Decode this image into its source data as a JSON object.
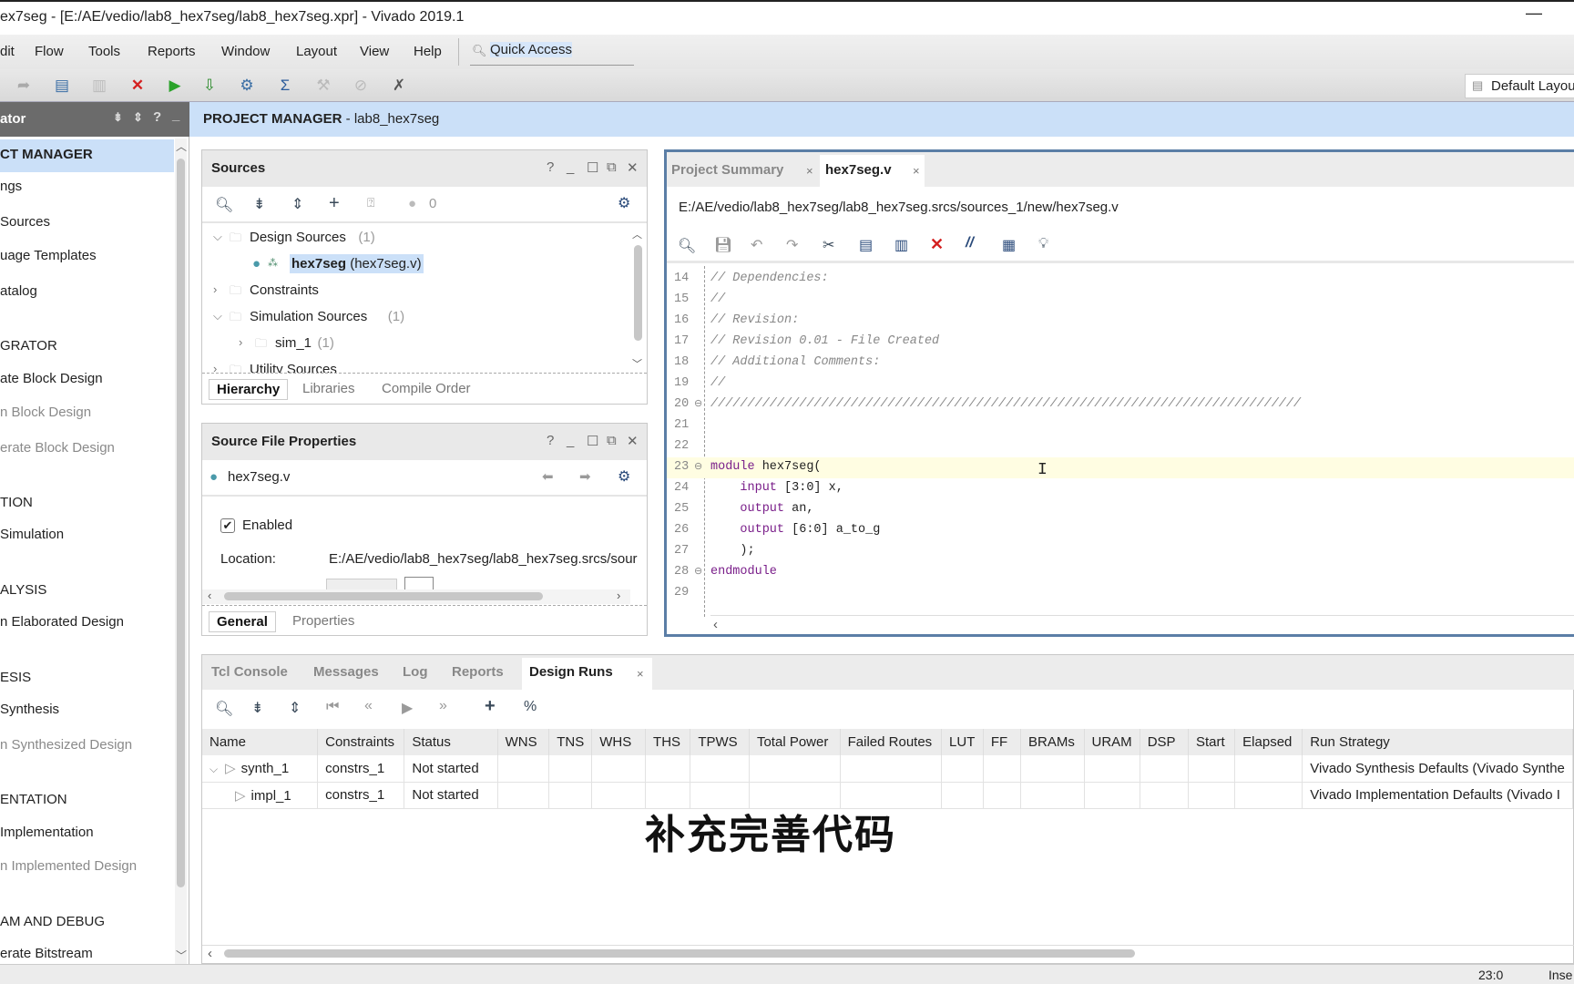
{
  "window": {
    "title": "ex7seg - [E:/AE/vedio/lab8_hex7seg/lab8_hex7seg.xpr] - Vivado 2019.1",
    "minimize_icon": "minimize-icon"
  },
  "menu": {
    "items": [
      "dit",
      "Flow",
      "Tools",
      "Reports",
      "Window",
      "Layout",
      "View",
      "Help"
    ],
    "quick_access": "Quick Access"
  },
  "toolbar": {
    "layout_label": "Default Layout",
    "icons": [
      "redo-icon",
      "copy-icon",
      "paste-icon",
      "delete-icon",
      "run-icon",
      "program-icon",
      "settings-icon",
      "sigma-icon",
      "disabled-tool-icon",
      "disabled-tool-icon",
      "cancel-tool-icon"
    ]
  },
  "navigator": {
    "title": "ator",
    "items": [
      {
        "label": "CT MANAGER",
        "type": "section",
        "selected": true
      },
      {
        "label": "ngs",
        "type": "item"
      },
      {
        "label": "Sources",
        "type": "item"
      },
      {
        "label": "uage Templates",
        "type": "item"
      },
      {
        "label": "atalog",
        "type": "item"
      },
      {
        "label": "GRATOR",
        "type": "section"
      },
      {
        "label": "ate Block Design",
        "type": "item"
      },
      {
        "label": "n Block Design",
        "type": "item",
        "disabled": true
      },
      {
        "label": "erate Block Design",
        "type": "item",
        "disabled": true
      },
      {
        "label": "TION",
        "type": "section"
      },
      {
        "label": "Simulation",
        "type": "item"
      },
      {
        "label": "ALYSIS",
        "type": "section"
      },
      {
        "label": "n Elaborated Design",
        "type": "item"
      },
      {
        "label": "ESIS",
        "type": "section"
      },
      {
        "label": "Synthesis",
        "type": "item"
      },
      {
        "label": "n Synthesized Design",
        "type": "item",
        "disabled": true
      },
      {
        "label": "ENTATION",
        "type": "section"
      },
      {
        "label": "Implementation",
        "type": "item"
      },
      {
        "label": "n Implemented Design",
        "type": "item",
        "disabled": true
      },
      {
        "label": "AM AND DEBUG",
        "type": "section"
      },
      {
        "label": "erate Bitstream",
        "type": "item"
      }
    ]
  },
  "project_manager": {
    "title": "PROJECT MANAGER",
    "project": " - lab8_hex7seg"
  },
  "sources": {
    "title": "Sources",
    "count": "0",
    "tree": [
      {
        "label": "Design Sources",
        "count": "(1)",
        "expanded": true,
        "level": 0
      },
      {
        "label": "hex7seg",
        "detail": "(hex7seg.v)",
        "level": 1,
        "selected": true
      },
      {
        "label": "Constraints",
        "count": "",
        "expanded": false,
        "level": 0
      },
      {
        "label": "Simulation Sources",
        "count": "(1)",
        "expanded": true,
        "level": 0
      },
      {
        "label": "sim_1",
        "count": "(1)",
        "expanded": false,
        "level": 1
      },
      {
        "label": "Utility Sources",
        "count": "",
        "expanded": false,
        "level": 0
      }
    ],
    "tabs": [
      "Hierarchy",
      "Libraries",
      "Compile Order"
    ]
  },
  "file_properties": {
    "title": "Source File Properties",
    "file": "hex7seg.v",
    "enabled_label": "Enabled",
    "enabled": true,
    "location_label": "Location:",
    "location": "E:/AE/vedio/lab8_hex7seg/lab8_hex7seg.srcs/sour",
    "tabs": [
      "General",
      "Properties"
    ]
  },
  "editor": {
    "tabs": [
      "Project Summary",
      "hex7seg.v"
    ],
    "active_tab": 1,
    "path": "E:/AE/vedio/lab8_hex7seg/lab8_hex7seg.srcs/sources_1/new/hex7seg.v",
    "lines": [
      {
        "n": "14",
        "text": "// Dependencies:",
        "cls": "cm"
      },
      {
        "n": "15",
        "text": "//",
        "cls": "cm"
      },
      {
        "n": "16",
        "text": "// Revision:",
        "cls": "cm"
      },
      {
        "n": "17",
        "text": "// Revision 0.01 - File Created",
        "cls": "cm"
      },
      {
        "n": "18",
        "text": "// Additional Comments:",
        "cls": "cm"
      },
      {
        "n": "19",
        "text": "//",
        "cls": "cm"
      },
      {
        "n": "20",
        "text": "////////////////////////////////////////////////////////////////////////////////",
        "cls": "cm",
        "fold": true
      },
      {
        "n": "21",
        "text": ""
      },
      {
        "n": "22",
        "text": ""
      },
      {
        "n": "23",
        "text": "module hex7seg(",
        "fold": true,
        "current": true
      },
      {
        "n": "24",
        "text": "    input [3:0] x,"
      },
      {
        "n": "25",
        "text": "    output an,"
      },
      {
        "n": "26",
        "text": "    output [6:0] a_to_g"
      },
      {
        "n": "27",
        "text": "    );"
      },
      {
        "n": "28",
        "text": "endmodule",
        "fold": true
      },
      {
        "n": "29",
        "text": ""
      }
    ]
  },
  "bottom": {
    "tabs": [
      "Tcl Console",
      "Messages",
      "Log",
      "Reports",
      "Design Runs"
    ],
    "active_tab": 4,
    "columns": [
      "Name",
      "Constraints",
      "Status",
      "WNS",
      "TNS",
      "WHS",
      "THS",
      "TPWS",
      "Total Power",
      "Failed Routes",
      "LUT",
      "FF",
      "BRAMs",
      "URAM",
      "DSP",
      "Start",
      "Elapsed",
      "Run Strategy"
    ],
    "rows": [
      {
        "name": "synth_1",
        "constraints": "constrs_1",
        "status": "Not started",
        "strategy": "Vivado Synthesis Defaults (Vivado Synthe"
      },
      {
        "name": "impl_1",
        "constraints": "constrs_1",
        "status": "Not started",
        "strategy": "Vivado Implementation Defaults (Vivado I"
      }
    ]
  },
  "status": {
    "position": "23:0",
    "mode": "Inse"
  },
  "subtitle": "补充完善代码",
  "colors": {
    "accent": "#5b7ea6",
    "selection": "#cbe0f8",
    "run": "#2aa22a",
    "delete": "#d42020"
  }
}
